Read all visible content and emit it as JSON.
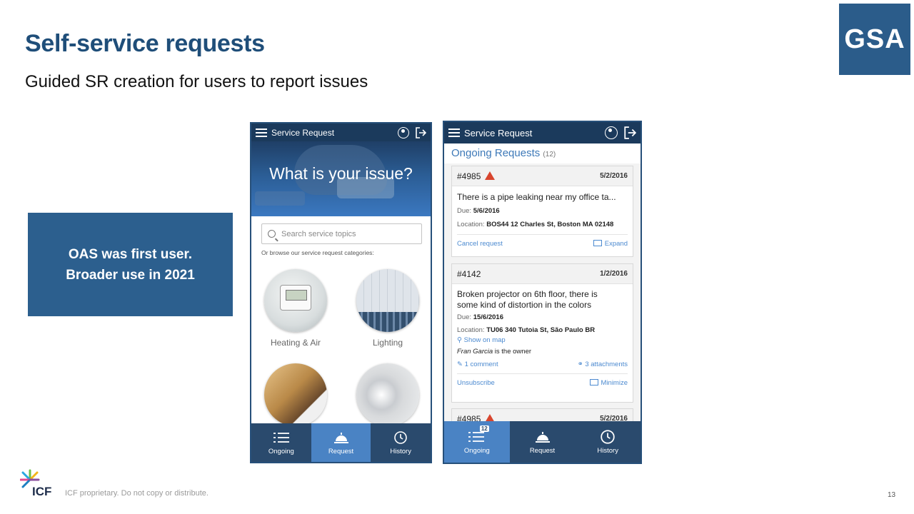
{
  "slide": {
    "title": "Self-service requests",
    "subtitle": "Guided SR creation for users to report issues",
    "logo_text": "GSA",
    "callout_line1": "OAS was first user.",
    "callout_line2": "Broader use in 2021",
    "footer": "ICF proprietary. Do not copy or distribute.",
    "brand": "ICF",
    "page_number": "13"
  },
  "phone1": {
    "app_title": "Service Request",
    "hero_text": "What is your issue?",
    "search_placeholder": "Search service topics",
    "browse_text": "Or browse our service request categories:",
    "categories": [
      "Heating & Air",
      "Lighting",
      "",
      ""
    ],
    "tabs": [
      "Ongoing",
      "Request",
      "History"
    ],
    "active_tab": "Request"
  },
  "phone2": {
    "app_title": "Service Request",
    "section_title": "Ongoing Requests",
    "section_count": "(12)",
    "badge_count": "12",
    "tabs": [
      "Ongoing",
      "Request",
      "History"
    ],
    "active_tab": "Ongoing",
    "cards": [
      {
        "id": "#4985",
        "date": "5/2/2016",
        "description": "There is a pipe leaking near my office ta...",
        "due_label": "Due:",
        "due": "5/6/2016",
        "location_label": "Location:",
        "location": "BOS44 12 Charles St, Boston MA 02148",
        "action_left": "Cancel request",
        "action_right": "Expand"
      },
      {
        "id": "#4142",
        "date": "1/2/2016",
        "description_line1": "Broken projector on 6th floor, there is",
        "description_line2": "some kind of distortion in the colors",
        "due_label": "Due:",
        "due": "15/6/2016",
        "location_label": "Location:",
        "location": "TU06 340 Tutoia St, São Paulo BR",
        "map_link": "Show on map",
        "owner_name": "Fran Garcia",
        "owner_suffix": " is the owner",
        "comments": "1 comment",
        "attachments": "3 attachments",
        "action_left": "Unsubscribe",
        "action_right": "Minimize"
      },
      {
        "id": "#4985",
        "date": "5/2/2016"
      }
    ]
  },
  "colors": {
    "title_blue": "#1f4e79",
    "callout_bg": "#2c5f8e",
    "app_bar": "#1b3a5c",
    "tab_bar": "#2a4a6d",
    "tab_active": "#4a83c4",
    "link_blue": "#4c8ad0",
    "warning_red": "#d8452e"
  }
}
